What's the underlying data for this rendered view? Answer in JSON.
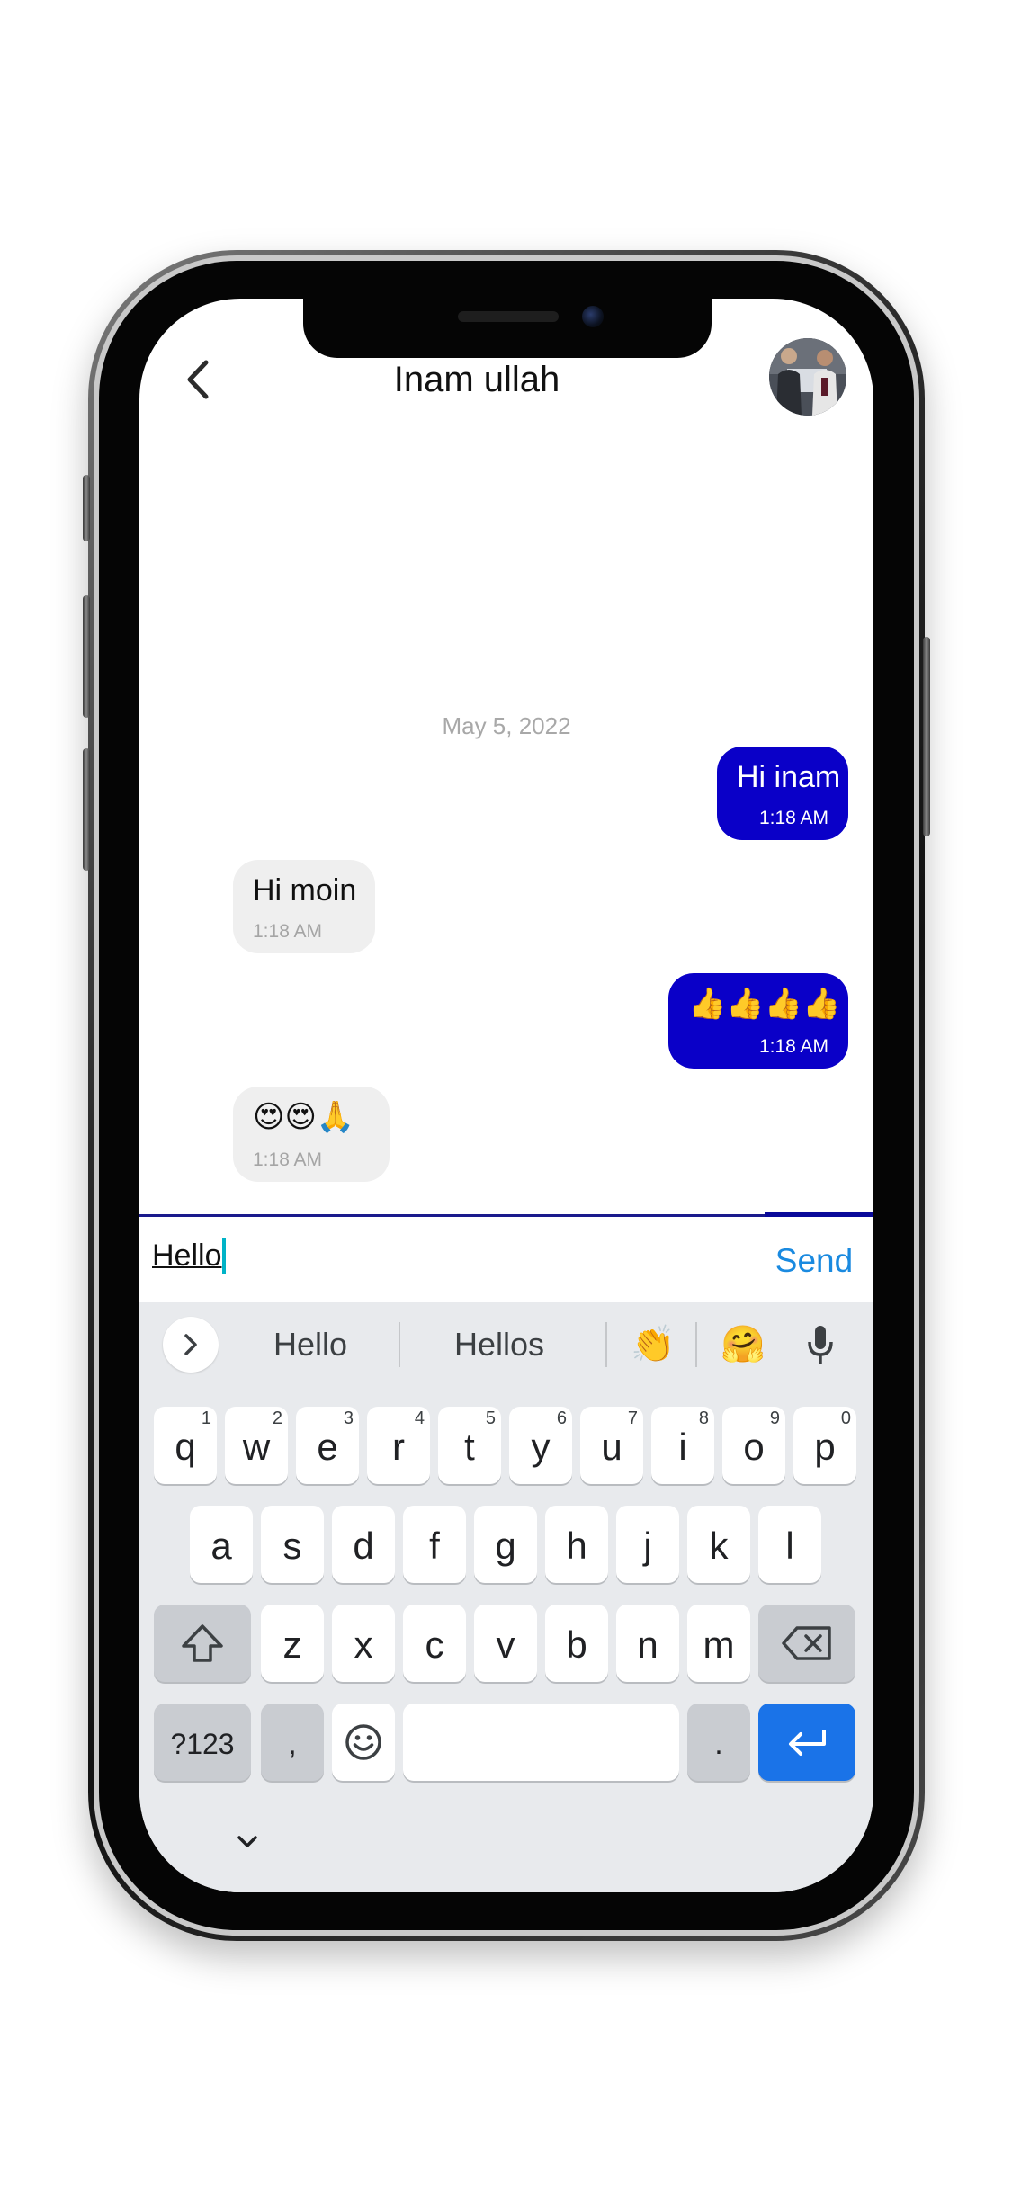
{
  "header": {
    "title": "Inam ullah",
    "back_icon": "chevron-left-icon",
    "avatar_icon": "contact-avatar"
  },
  "conversation": {
    "date": "May 5, 2022",
    "messages": [
      {
        "direction": "outgoing",
        "text": "Hi inam",
        "time": "1:18 AM"
      },
      {
        "direction": "incoming",
        "text": "Hi moin",
        "time": "1:18 AM"
      },
      {
        "direction": "outgoing",
        "text": "👍👍👍👍",
        "time": "1:18 AM"
      },
      {
        "direction": "incoming",
        "text": "😍😍🙏",
        "time": "1:18 AM"
      }
    ]
  },
  "composer": {
    "input_value": "Hello",
    "send_label": "Send"
  },
  "keyboard": {
    "suggestions": [
      "Hello",
      "Hellos"
    ],
    "emoji_suggestions": [
      "👏",
      "🤗"
    ],
    "row1": [
      {
        "key": "q",
        "hint": "1"
      },
      {
        "key": "w",
        "hint": "2"
      },
      {
        "key": "e",
        "hint": "3"
      },
      {
        "key": "r",
        "hint": "4"
      },
      {
        "key": "t",
        "hint": "5"
      },
      {
        "key": "y",
        "hint": "6"
      },
      {
        "key": "u",
        "hint": "7"
      },
      {
        "key": "i",
        "hint": "8"
      },
      {
        "key": "o",
        "hint": "9"
      },
      {
        "key": "p",
        "hint": "0"
      }
    ],
    "row2": [
      "a",
      "s",
      "d",
      "f",
      "g",
      "h",
      "j",
      "k",
      "l"
    ],
    "row3": [
      "z",
      "x",
      "c",
      "v",
      "b",
      "n",
      "m"
    ],
    "symbols_label": "?123",
    "comma_label": ",",
    "period_label": ".",
    "colors": {
      "outgoing_bubble": "#0a00c8",
      "incoming_bubble": "#efefef",
      "send_text": "#1a8ae0",
      "enter_key": "#1a73e8",
      "caret": "#00b3c7"
    }
  }
}
